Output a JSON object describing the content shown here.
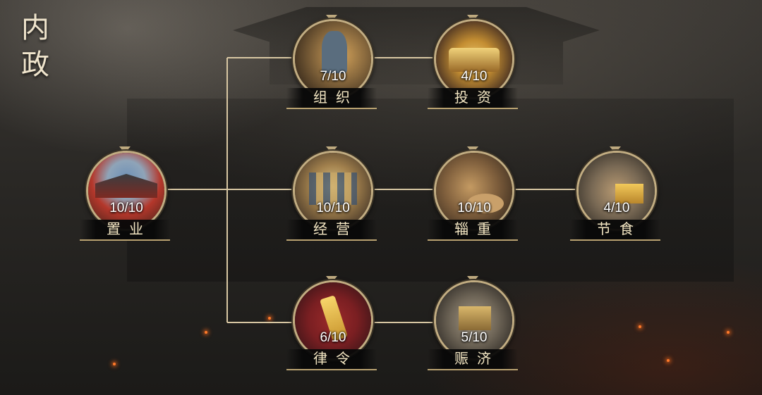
{
  "title": {
    "line1": "内",
    "line2": "政"
  },
  "nodes": {
    "zhiye": {
      "name": "置业",
      "count": "10/10",
      "icon": "palace-icon"
    },
    "zuzhi": {
      "name": "组织",
      "count": "7/10",
      "icon": "official-icon"
    },
    "touzi": {
      "name": "投资",
      "count": "4/10",
      "icon": "treasure-chest-icon"
    },
    "jingying": {
      "name": "经营",
      "count": "10/10",
      "icon": "market-icon"
    },
    "ziZhong": {
      "name": "辎重",
      "count": "10/10",
      "icon": "supply-cart-icon"
    },
    "jieshi": {
      "name": "节食",
      "count": "4/10",
      "icon": "grain-sacks-icon"
    },
    "lvling": {
      "name": "律令",
      "count": "6/10",
      "icon": "decree-scroll-icon"
    },
    "zhenji": {
      "name": "赈济",
      "count": "5/10",
      "icon": "relief-crate-icon"
    }
  },
  "colors": {
    "frame": "#c2ad82",
    "line": "#d8c7a3",
    "label": "#f3e6c3"
  }
}
